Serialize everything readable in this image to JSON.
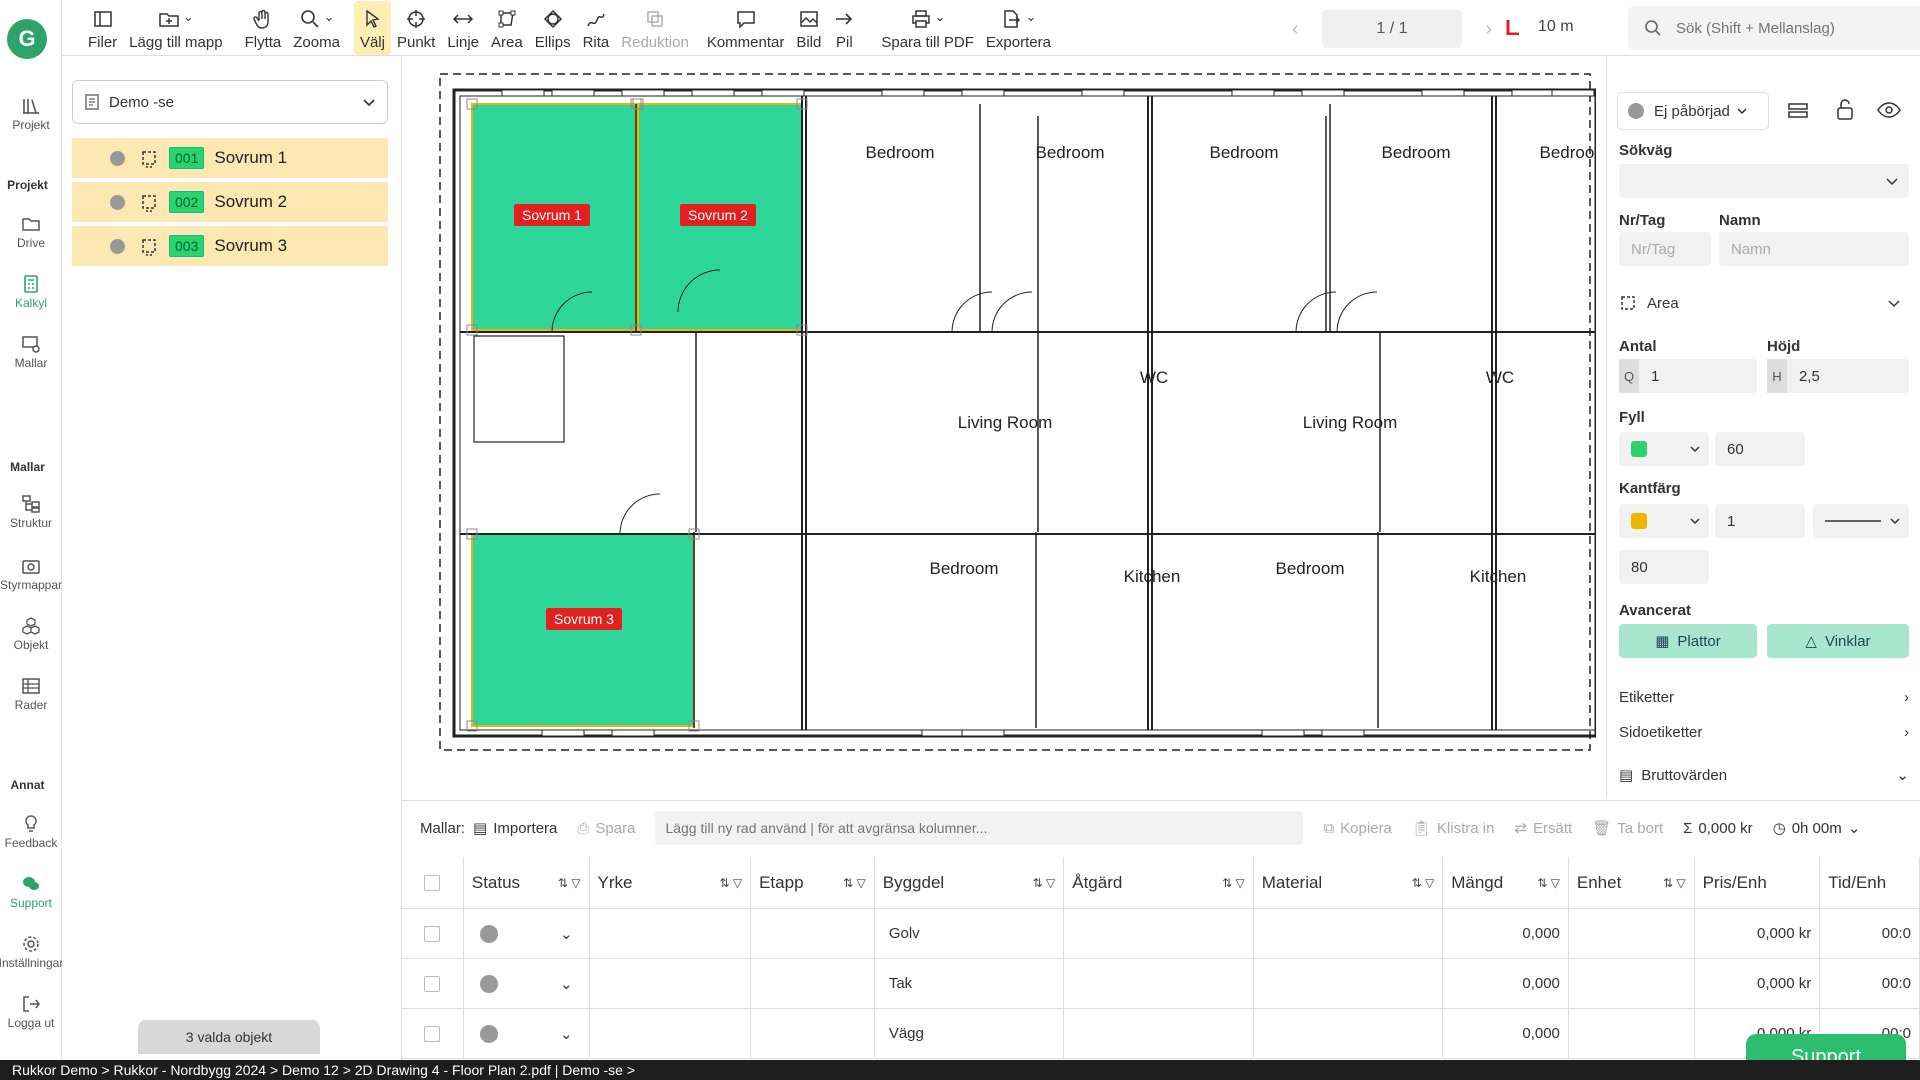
{
  "toolbar": {
    "items": [
      {
        "label": "Filer",
        "icon": "sidebar-toggle-icon"
      },
      {
        "label": "Lägg till mapp",
        "icon": "folder-plus-icon"
      },
      {
        "label": "Flytta",
        "icon": "hand-icon"
      },
      {
        "label": "Zooma",
        "icon": "magnifier-icon"
      },
      {
        "label": "Välj",
        "icon": "cursor-icon",
        "active": true
      },
      {
        "label": "Punkt",
        "icon": "crosshair-icon"
      },
      {
        "label": "Linje",
        "icon": "line-arrows-icon"
      },
      {
        "label": "Area",
        "icon": "area-icon"
      },
      {
        "label": "Ellips",
        "icon": "ellipse-icon"
      },
      {
        "label": "Rita",
        "icon": "pen-icon"
      },
      {
        "label": "Reduktion",
        "icon": "reduction-icon",
        "disabled": true
      },
      {
        "label": "Kommentar",
        "icon": "comment-icon"
      },
      {
        "label": "Bild",
        "icon": "image-icon"
      },
      {
        "label": "Pil",
        "icon": "arrow-icon"
      },
      {
        "label": "Spara till PDF",
        "icon": "printer-icon"
      },
      {
        "label": "Exportera",
        "icon": "export-icon"
      }
    ],
    "page_indicator": "1 / 1",
    "scale_label": "10 m",
    "search_placeholder": "Sök (Shift + Mellanslag)"
  },
  "rail": {
    "logo": "G",
    "items": [
      {
        "label": "Projekt",
        "icon": "books-icon"
      },
      {
        "label": "Drive",
        "icon": "folder-icon"
      },
      {
        "label": "Kalkyl",
        "icon": "calculator-icon",
        "active": true
      },
      {
        "label": "Mallar",
        "icon": "template-icon"
      },
      {
        "label": "Struktur",
        "icon": "structure-icon"
      },
      {
        "label": "Styrmappar",
        "icon": "camera-folder-icon"
      },
      {
        "label": "Objekt",
        "icon": "cubes-icon"
      },
      {
        "label": "Rader",
        "icon": "rows-icon"
      },
      {
        "label": "Feedback",
        "icon": "bulb-icon"
      },
      {
        "label": "Support",
        "icon": "chat-icon",
        "active": true
      },
      {
        "label": "Inställningar",
        "icon": "gear-icon"
      },
      {
        "label": "Logga ut",
        "icon": "logout-icon"
      }
    ],
    "sections": {
      "projekt": "Projekt",
      "mallar": "Mallar",
      "annat": "Annat"
    }
  },
  "side": {
    "document": "Demo -se",
    "objects": [
      {
        "num": "001",
        "label": "Sovrum 1"
      },
      {
        "num": "002",
        "label": "Sovrum 2"
      },
      {
        "num": "003",
        "label": "Sovrum 3"
      }
    ],
    "selection_info": "3 valda objekt"
  },
  "plan": {
    "rooms": [
      "Bedroom",
      "Bedroom",
      "Bedroom",
      "Bedroom",
      "Bedroom",
      "Bedroom",
      "Bedr",
      "WC",
      "WC",
      "WC",
      "Living Room",
      "Living Room",
      "Living Room",
      "Livin",
      "Bedroom",
      "Bedroom",
      "Bedroom",
      "Bedr",
      "Kitchen",
      "Kitchen",
      "Kitchen"
    ],
    "tags": [
      "Sovrum 1",
      "Sovrum 2",
      "Sovrum 3"
    ],
    "fill_color": "#2fd699",
    "border_color": "#f0b400",
    "tag_color": "#e32020"
  },
  "props": {
    "status": "Ej påbörjad",
    "sokvag_label": "Sökväg",
    "nrtag_label": "Nr/Tag",
    "nrtag_placeholder": "Nr/Tag",
    "namn_label": "Namn",
    "namn_placeholder": "Namn",
    "type": "Area",
    "antal_label": "Antal",
    "antal_prefix": "Q",
    "antal_value": "1",
    "hojd_label": "Höjd",
    "hojd_prefix": "H",
    "hojd_value": "2,5",
    "fyll_label": "Fyll",
    "fyll_color": "#2bd36f",
    "fyll_value": "60",
    "kant_label": "Kantfärg",
    "kant_color": "#f0b400",
    "kant_width": "1",
    "kant_opacity": "80",
    "avancerat_label": "Avancerat",
    "plattor": "Plattor",
    "vinklar": "Vinklar",
    "etiketter": "Etiketter",
    "sidoetiketter": "Sidoetiketter",
    "bruttovarden": "Bruttovärden"
  },
  "table": {
    "mallar_label": "Mallar:",
    "importera": "Importera",
    "spara": "Spara",
    "input_placeholder": "Lägg till ny rad använd | för att avgränsa kolumner...",
    "kopiera": "Kopiera",
    "klistra": "Klistra in",
    "ersatt": "Ersätt",
    "tabort": "Ta bort",
    "sum": "0,000 kr",
    "time": "0h 00m",
    "columns": [
      "Status",
      "Yrke",
      "Etapp",
      "Byggdel",
      "Åtgärd",
      "Material",
      "Mängd",
      "Enhet",
      "Pris/Enh",
      "Tid/Enh"
    ],
    "rows": [
      {
        "byggdel": "Golv",
        "mangd": "0,000",
        "pris": "0,000 kr",
        "tid": "00:0"
      },
      {
        "byggdel": "Tak",
        "mangd": "0,000",
        "pris": "0,000 kr",
        "tid": "00:0"
      },
      {
        "byggdel": "Vägg",
        "mangd": "0,000",
        "pris": "0,000 kr",
        "tid": "00:0"
      }
    ]
  },
  "footer": {
    "breadcrumb": "Rukkor Demo > Rukkor - Nordbygg 2024 > Demo 12 > 2D Drawing 4 - Floor Plan 2.pdf  |  Demo -se >",
    "support": "Support"
  }
}
